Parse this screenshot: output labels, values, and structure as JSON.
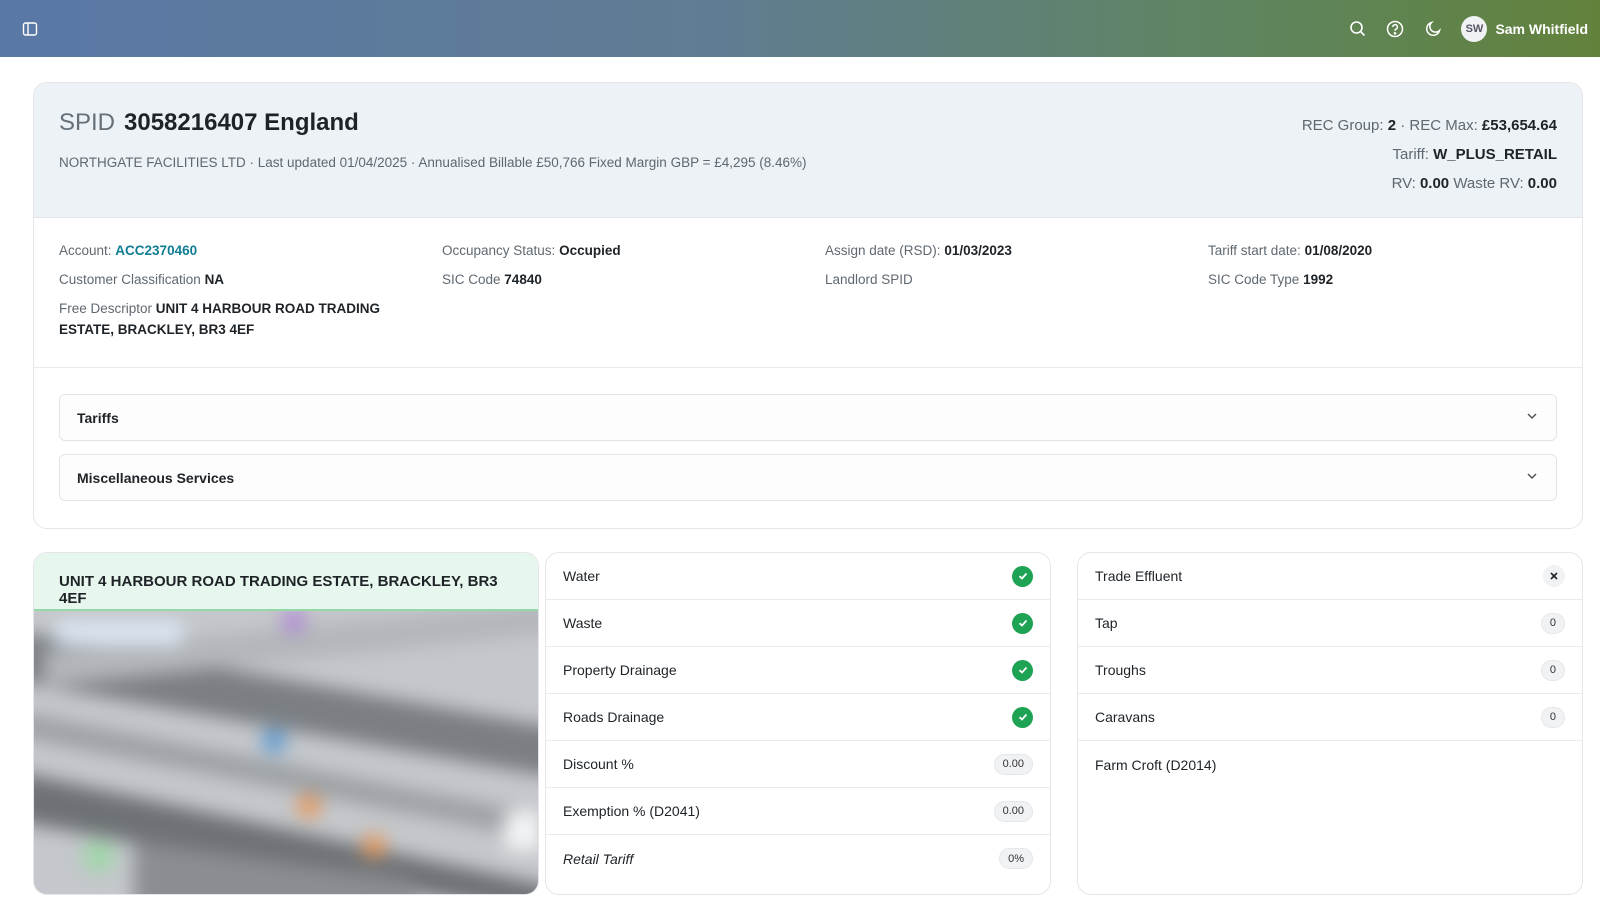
{
  "header": {
    "user_initials": "SW",
    "user_name": "Sam Whitfield",
    "icons": [
      "sidebar-toggle-icon",
      "search-icon",
      "help-icon",
      "moon-icon"
    ]
  },
  "summary": {
    "spid_label": "SPID",
    "spid_value": "3058216407 England",
    "subline": "NORTHGATE FACILITIES LTD · Last updated 01/04/2025 · Annualised Billable £50,766 Fixed Margin GBP = £4,295 (8.46%)",
    "rec_group_label": "REC Group:",
    "rec_group_value": "2",
    "rec_sep": " · ",
    "rec_max_label": "REC Max:",
    "rec_max_value": "£53,654.64",
    "tariff_label": "Tariff:",
    "tariff_value": "W_PLUS_RETAIL",
    "rv_label": "RV:",
    "rv_value": "0.00",
    "waste_rv_label": "Waste RV:",
    "waste_rv_value": "0.00"
  },
  "details": {
    "account_label": "Account:",
    "account_value": "ACC2370460",
    "classification_label": "Customer Classification",
    "classification_value": "NA",
    "descriptor_label": "Free Descriptor",
    "descriptor_value": "UNIT 4 HARBOUR ROAD TRADING ESTATE, BRACKLEY, BR3 4EF",
    "occupancy_label": "Occupancy Status:",
    "occupancy_value": "Occupied",
    "sic_code_label": "SIC Code",
    "sic_code_value": "74840",
    "assign_label": "Assign date (RSD):",
    "assign_value": "01/03/2023",
    "landlord_label": "Landlord SPID",
    "tariff_start_label": "Tariff start date:",
    "tariff_start_value": "01/08/2020",
    "sic_type_label": "SIC Code Type",
    "sic_type_value": "1992"
  },
  "accordions": {
    "tariffs": "Tariffs",
    "misc": "Miscellaneous Services"
  },
  "address_card": {
    "title": "UNIT 4 HARBOUR ROAD TRADING ESTATE, BRACKLEY, BR3 4EF"
  },
  "services": [
    {
      "label": "Water",
      "kind": "check"
    },
    {
      "label": "Waste",
      "kind": "check"
    },
    {
      "label": "Property Drainage",
      "kind": "check"
    },
    {
      "label": "Roads Drainage",
      "kind": "check"
    },
    {
      "label": "Discount %",
      "kind": "pill",
      "value": "0.00"
    },
    {
      "label": "Exemption % (D2041)",
      "kind": "pill",
      "value": "0.00"
    },
    {
      "label": "Retail Tariff",
      "kind": "pill",
      "value": "0%"
    }
  ],
  "extras": [
    {
      "label": "Trade Effluent",
      "kind": "x"
    },
    {
      "label": "Tap",
      "kind": "pill",
      "value": "0"
    },
    {
      "label": "Troughs",
      "kind": "pill",
      "value": "0"
    },
    {
      "label": "Caravans",
      "kind": "pill",
      "value": "0"
    },
    {
      "label": "Farm Croft (D2014)",
      "kind": "none"
    }
  ],
  "colors": {
    "accent_link": "#0f7e93",
    "check_green": "#1ea254",
    "address_header_bg": "#e8f7ed"
  }
}
